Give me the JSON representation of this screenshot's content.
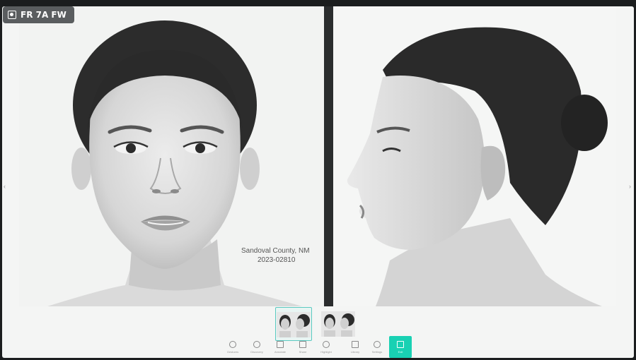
{
  "badge": {
    "label": "FR 7A FW",
    "icon": "room-marker-icon"
  },
  "case": {
    "location": "Sandoval County, NM",
    "number": "2023-02810"
  },
  "thumbnails": [
    {
      "id": "pair-1",
      "selected": true,
      "caption": ""
    },
    {
      "id": "pair-2",
      "selected": false,
      "caption": ""
    }
  ],
  "toolbar": {
    "tools": [
      {
        "id": "tool-1",
        "label": "Gestures",
        "icon": "gesture-icon"
      },
      {
        "id": "tool-2",
        "label": "Discovery",
        "icon": "discovery-icon"
      },
      {
        "id": "tool-3",
        "label": "Annotate",
        "icon": "annotate-icon"
      },
      {
        "id": "tool-4",
        "label": "Share",
        "icon": "share-icon"
      },
      {
        "id": "tool-5",
        "label": "Highlight",
        "icon": "highlight-icon"
      },
      {
        "id": "tool-6",
        "label": "Library",
        "icon": "library-icon"
      },
      {
        "id": "tool-7",
        "label": "Settings",
        "icon": "settings-icon"
      },
      {
        "id": "tool-8",
        "label": "Exit",
        "icon": "exit-icon",
        "active": true
      }
    ]
  },
  "colors": {
    "accent": "#19d1b3",
    "selection": "#5bc9c0",
    "frame": "#1b1d1e"
  }
}
